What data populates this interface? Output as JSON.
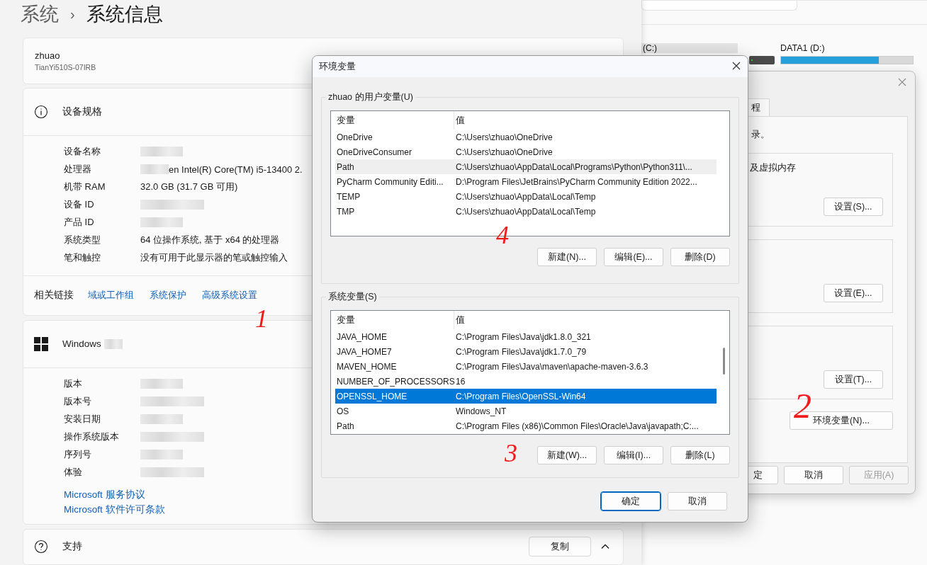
{
  "background_window": {
    "drives": [
      {
        "label": "(C:)"
      },
      {
        "label": "DATA1 (D:)",
        "level": 0.74
      }
    ]
  },
  "settings": {
    "breadcrumb_parent": "系统",
    "breadcrumb_separator": "›",
    "title": "系统信息",
    "device": {
      "name": "zhuao",
      "model": "TianYi510S-07IRB"
    },
    "spec_section": {
      "title": "设备规格",
      "rows": [
        {
          "label": "设备名称",
          "redacted": true
        },
        {
          "label": "处理器",
          "value": "en Intel(R) Core(TM) i5-13400   2.",
          "redacted": true
        },
        {
          "label": "机带 RAM",
          "value": "32.0 GB (31.7 GB 可用)",
          "redacted": false
        },
        {
          "label": "设备 ID",
          "redacted": true
        },
        {
          "label": "产品 ID",
          "redacted": true
        },
        {
          "label": "系统类型",
          "value": "64 位操作系统, 基于 x64 的处理器",
          "redacted": false
        },
        {
          "label": "笔和触控",
          "value": "没有可用于此显示器的笔或触控输入",
          "redacted": false
        }
      ]
    },
    "related_links": {
      "label": "相关链接",
      "links": [
        "域或工作组",
        "系统保护",
        "高级系统设置"
      ]
    },
    "windows_section": {
      "title": "Windows",
      "title_redacted": true,
      "rows": [
        {
          "label": "版本",
          "redacted": true
        },
        {
          "label": "版本号",
          "redacted": true
        },
        {
          "label": "安装日期",
          "redacted": true
        },
        {
          "label": "操作系统版本",
          "redacted": true
        },
        {
          "label": "序列号",
          "redacted": true
        },
        {
          "label": "体验",
          "redacted": true
        }
      ],
      "links": [
        "Microsoft 服务协议",
        "Microsoft 软件许可条款"
      ]
    },
    "support": {
      "title": "支持",
      "button": "复制",
      "expanded": true
    }
  },
  "system_properties": {
    "tab": "程",
    "intro": "录。",
    "groups": [
      {
        "text": "及虚拟内存",
        "button": "设置(S)..."
      },
      {
        "button": "设置(E)..."
      },
      {
        "button": "设置(T)..."
      }
    ],
    "env_button": "环境变量(N)...",
    "footer": [
      {
        "label": "定",
        "disabled": false
      },
      {
        "label": "取消",
        "disabled": false
      },
      {
        "label": "应用(A)",
        "disabled": true
      }
    ]
  },
  "env_dialog": {
    "title": "环境变量",
    "groups": [
      {
        "title": "zhuao 的用户变量(U)",
        "focused": false,
        "scrollbar": false,
        "columns": [
          "变量",
          "值"
        ],
        "rows": [
          {
            "name": "OneDrive",
            "value": "C:\\Users\\zhuao\\OneDrive",
            "selected": false
          },
          {
            "name": "OneDriveConsumer",
            "value": "C:\\Users\\zhuao\\OneDrive",
            "selected": false
          },
          {
            "name": "Path",
            "value": "C:\\Users\\zhuao\\AppData\\Local\\Programs\\Python\\Python311\\...",
            "selected": true
          },
          {
            "name": "PyCharm Community Editi...",
            "value": "D:\\Program Files\\JetBrains\\PyCharm Community Edition 2022...",
            "selected": false
          },
          {
            "name": "TEMP",
            "value": "C:\\Users\\zhuao\\AppData\\Local\\Temp",
            "selected": false
          },
          {
            "name": "TMP",
            "value": "C:\\Users\\zhuao\\AppData\\Local\\Temp",
            "selected": false
          }
        ],
        "buttons": [
          "新建(N)...",
          "编辑(E)...",
          "删除(D)"
        ]
      },
      {
        "title": "系统变量(S)",
        "focused": true,
        "scrollbar": true,
        "columns": [
          "变量",
          "值"
        ],
        "rows": [
          {
            "name": "JAVA_HOME",
            "value": "C:\\Program Files\\Java\\jdk1.8.0_321",
            "selected": false
          },
          {
            "name": "JAVA_HOME7",
            "value": "C:\\Program Files\\Java\\jdk1.7.0_79",
            "selected": false
          },
          {
            "name": "MAVEN_HOME",
            "value": "C:\\Program Files\\Java\\maven\\apache-maven-3.6.3",
            "selected": false
          },
          {
            "name": "NUMBER_OF_PROCESSORS",
            "value": "16",
            "selected": false
          },
          {
            "name": "OPENSSL_HOME",
            "value": "C:\\Program Files\\OpenSSL-Win64",
            "selected": true
          },
          {
            "name": "OS",
            "value": "Windows_NT",
            "selected": false
          },
          {
            "name": "Path",
            "value": "C:\\Program Files (x86)\\Common Files\\Oracle\\Java\\javapath;C:...",
            "selected": false
          }
        ],
        "buttons": [
          "新建(W)...",
          "编辑(I)...",
          "删除(L)"
        ]
      }
    ],
    "footer": [
      {
        "label": "确定",
        "default": true
      },
      {
        "label": "取消",
        "default": false
      }
    ]
  },
  "annotations": [
    "1",
    "2",
    "3",
    "4"
  ]
}
